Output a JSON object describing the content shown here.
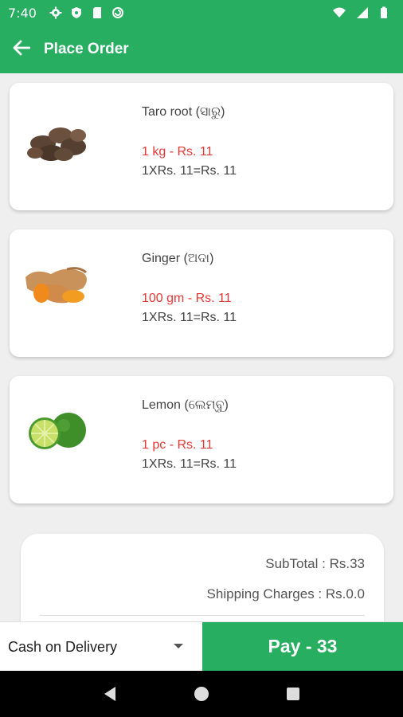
{
  "status_bar": {
    "time": "7:40",
    "left_icons": [
      "settings-icon",
      "shield-icon",
      "sim-card-icon",
      "sync-icon"
    ],
    "right_icons": [
      "wifi-icon",
      "signal-icon",
      "battery-icon"
    ]
  },
  "app_bar": {
    "title": "Place Order",
    "back_icon": "arrow-back-icon"
  },
  "items": [
    {
      "name": "Taro root (ସାରୁ)",
      "price": "1 kg  - Rs. 11",
      "calc": "1XRs. 11=Rs. 11",
      "image": "taro-root-image"
    },
    {
      "name": "Ginger (ଅଦା)",
      "price": "100 gm - Rs. 11",
      "calc": "1XRs. 11=Rs. 11",
      "image": "ginger-image"
    },
    {
      "name": "Lemon (ଲେମ୍ବୁ)",
      "price": "1 pc - Rs. 11",
      "calc": "1XRs. 11=Rs. 11",
      "image": "lemon-image"
    }
  ],
  "summary": {
    "subtotal": "SubTotal : Rs.33",
    "shipping": "Shipping Charges : Rs.0.0"
  },
  "bottom_bar": {
    "payment_method": "Cash on Delivery",
    "pay_button": "Pay - 33"
  },
  "nav_bar": {
    "icons": [
      "back-triangle-icon",
      "home-circle-icon",
      "recents-square-icon"
    ]
  },
  "colors": {
    "primary": "#27ae60",
    "price": "#e53935"
  }
}
